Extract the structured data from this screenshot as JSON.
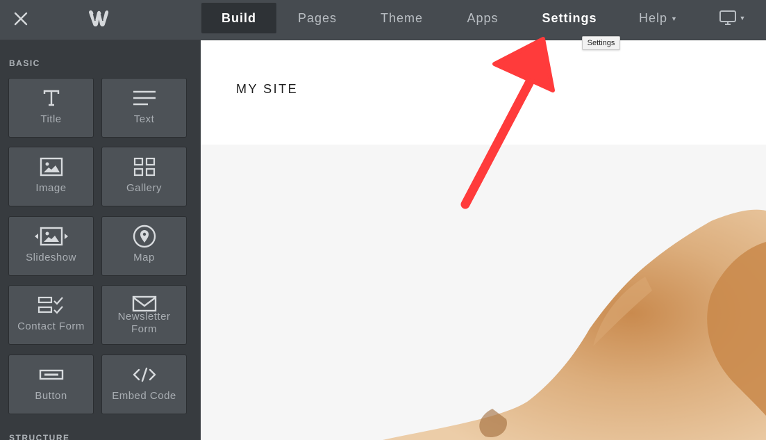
{
  "topbar": {
    "nav": [
      {
        "label": "Build"
      },
      {
        "label": "Pages"
      },
      {
        "label": "Theme"
      },
      {
        "label": "Apps"
      },
      {
        "label": "Settings"
      },
      {
        "label": "Help"
      }
    ],
    "tooltip": "Settings"
  },
  "sidebar": {
    "section_basic": "BASIC",
    "section_structure": "STRUCTURE",
    "tiles": [
      {
        "label": "Title",
        "icon": "title-icon"
      },
      {
        "label": "Text",
        "icon": "text-icon"
      },
      {
        "label": "Image",
        "icon": "image-icon"
      },
      {
        "label": "Gallery",
        "icon": "gallery-icon"
      },
      {
        "label": "Slideshow",
        "icon": "slideshow-icon"
      },
      {
        "label": "Map",
        "icon": "map-pin-icon"
      },
      {
        "label": "Contact Form",
        "icon": "contact-form-icon"
      },
      {
        "label": "Newsletter Form",
        "icon": "envelope-icon"
      },
      {
        "label": "Button",
        "icon": "button-icon"
      },
      {
        "label": "Embed Code",
        "icon": "code-icon"
      }
    ]
  },
  "canvas": {
    "site_title": "MY SITE"
  },
  "colors": {
    "topbar": "#464b50",
    "sidebar": "#373b3f",
    "tile": "#4d5257",
    "arrow": "#ff3b3b"
  }
}
